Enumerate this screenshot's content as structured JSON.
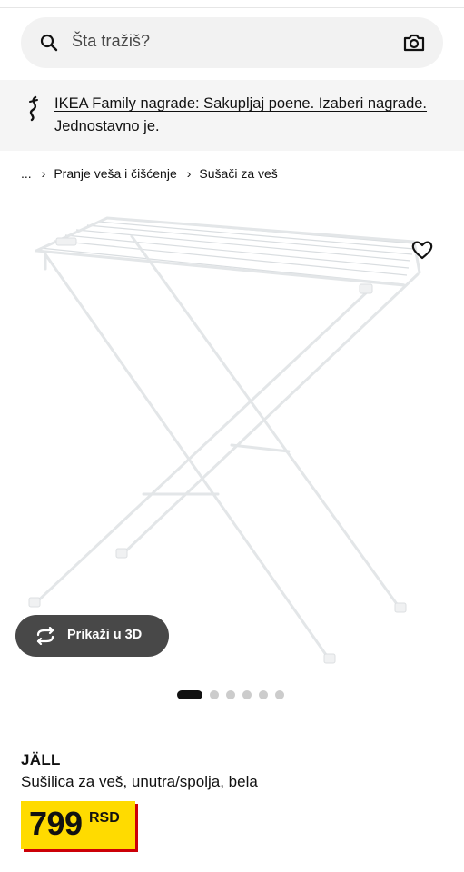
{
  "search": {
    "placeholder": "Šta tražiš?",
    "icon": "search-icon",
    "camera_icon": "camera-icon"
  },
  "promo": {
    "icon": "ikea-family-icon",
    "text": "IKEA Family nagrade: Sakupljaj poene. Izaberi nagrade. Jednostavno je."
  },
  "breadcrumb": {
    "items": [
      "...",
      "Pranje veša i čišćenje",
      "Sušači za veš"
    ],
    "separator": "›"
  },
  "product": {
    "image": "drying-rack-image",
    "favorite_icon": "heart-icon",
    "view_3d_label": "Prikaži u 3D",
    "view_3d_icon": "rotate-3d-icon",
    "gallery": {
      "count": 6,
      "active": 0
    },
    "name": "JÄLL",
    "description": "Sušilica za veš, unutra/spolja, bela",
    "price": "799",
    "currency": "RSD"
  },
  "colors": {
    "price_background": "#ffdb00",
    "price_shadow": "#cc0008",
    "button_3d": "#484848"
  }
}
